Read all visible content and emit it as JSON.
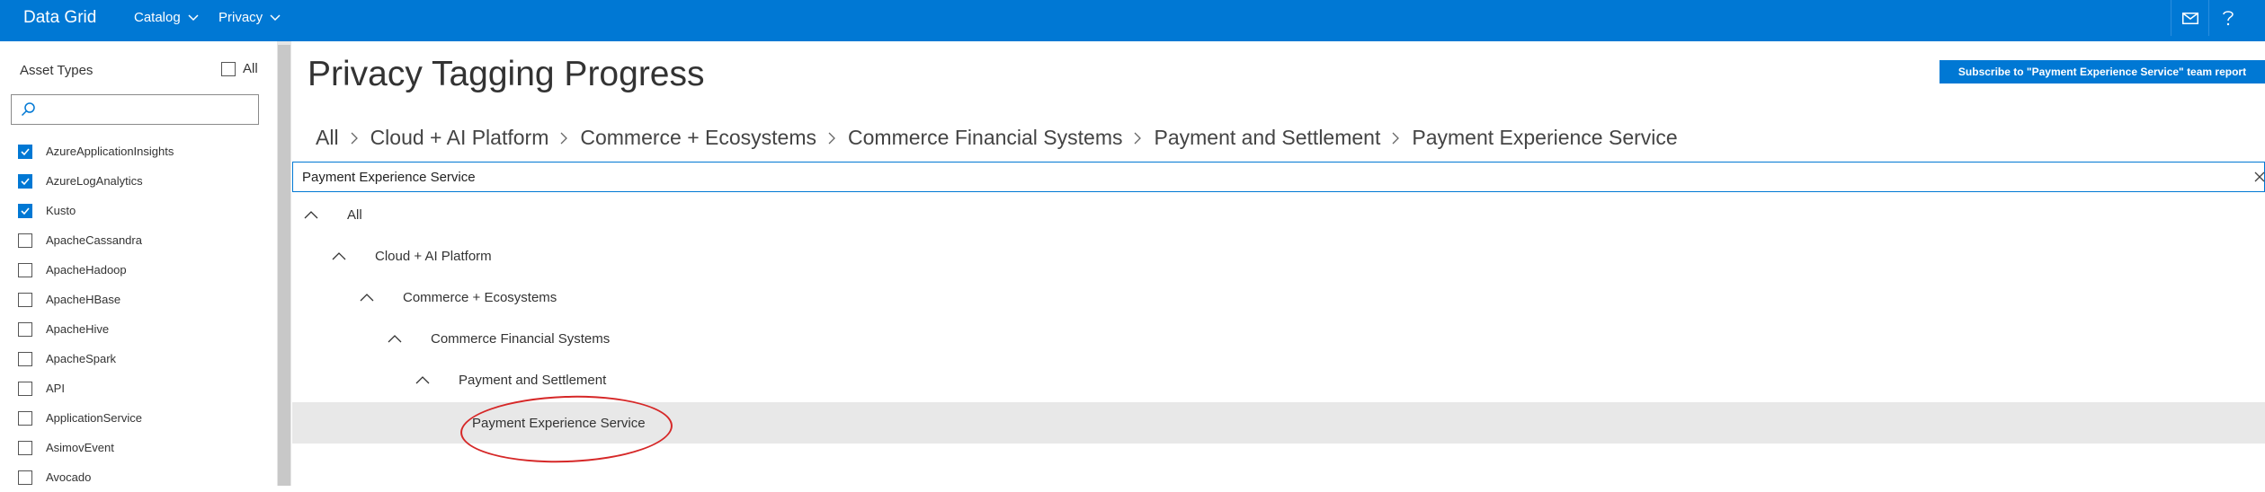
{
  "app": {
    "brand": "Data Grid"
  },
  "topnav": {
    "menus": [
      {
        "label": "Catalog"
      },
      {
        "label": "Privacy"
      }
    ],
    "icons": [
      "mail-icon",
      "help-icon"
    ]
  },
  "sidebar": {
    "title": "Asset Types",
    "select_all_label": "All",
    "select_all_checked": false,
    "search_placeholder": "",
    "items": [
      {
        "label": "AzureApplicationInsights",
        "checked": true
      },
      {
        "label": "AzureLogAnalytics",
        "checked": true
      },
      {
        "label": "Kusto",
        "checked": true
      },
      {
        "label": "ApacheCassandra",
        "checked": false
      },
      {
        "label": "ApacheHadoop",
        "checked": false
      },
      {
        "label": "ApacheHBase",
        "checked": false
      },
      {
        "label": "ApacheHive",
        "checked": false
      },
      {
        "label": "ApacheSpark",
        "checked": false
      },
      {
        "label": "API",
        "checked": false
      },
      {
        "label": "ApplicationService",
        "checked": false
      },
      {
        "label": "AsimovEvent",
        "checked": false
      },
      {
        "label": "Avocado",
        "checked": false
      }
    ]
  },
  "main": {
    "title": "Privacy Tagging Progress",
    "subscribe_label": "Subscribe to \"Payment Experience Service\" team report",
    "breadcrumb": [
      "All",
      "Cloud + AI Platform",
      "Commerce + Ecosystems",
      "Commerce Financial Systems",
      "Payment and Settlement",
      "Payment Experience Service"
    ],
    "filter_value": "Payment Experience Service",
    "tree": [
      {
        "label": "All",
        "expanded": true
      },
      {
        "label": "Cloud + AI Platform",
        "expanded": true
      },
      {
        "label": "Commerce + Ecosystems",
        "expanded": true
      },
      {
        "label": "Commerce Financial Systems",
        "expanded": true
      },
      {
        "label": "Payment and Settlement",
        "expanded": true
      },
      {
        "label": "Payment Experience Service",
        "selected": true
      }
    ]
  },
  "colors": {
    "accent": "#0078d4",
    "selected_row": "#e8e8e8",
    "annotation": "#d62828"
  }
}
